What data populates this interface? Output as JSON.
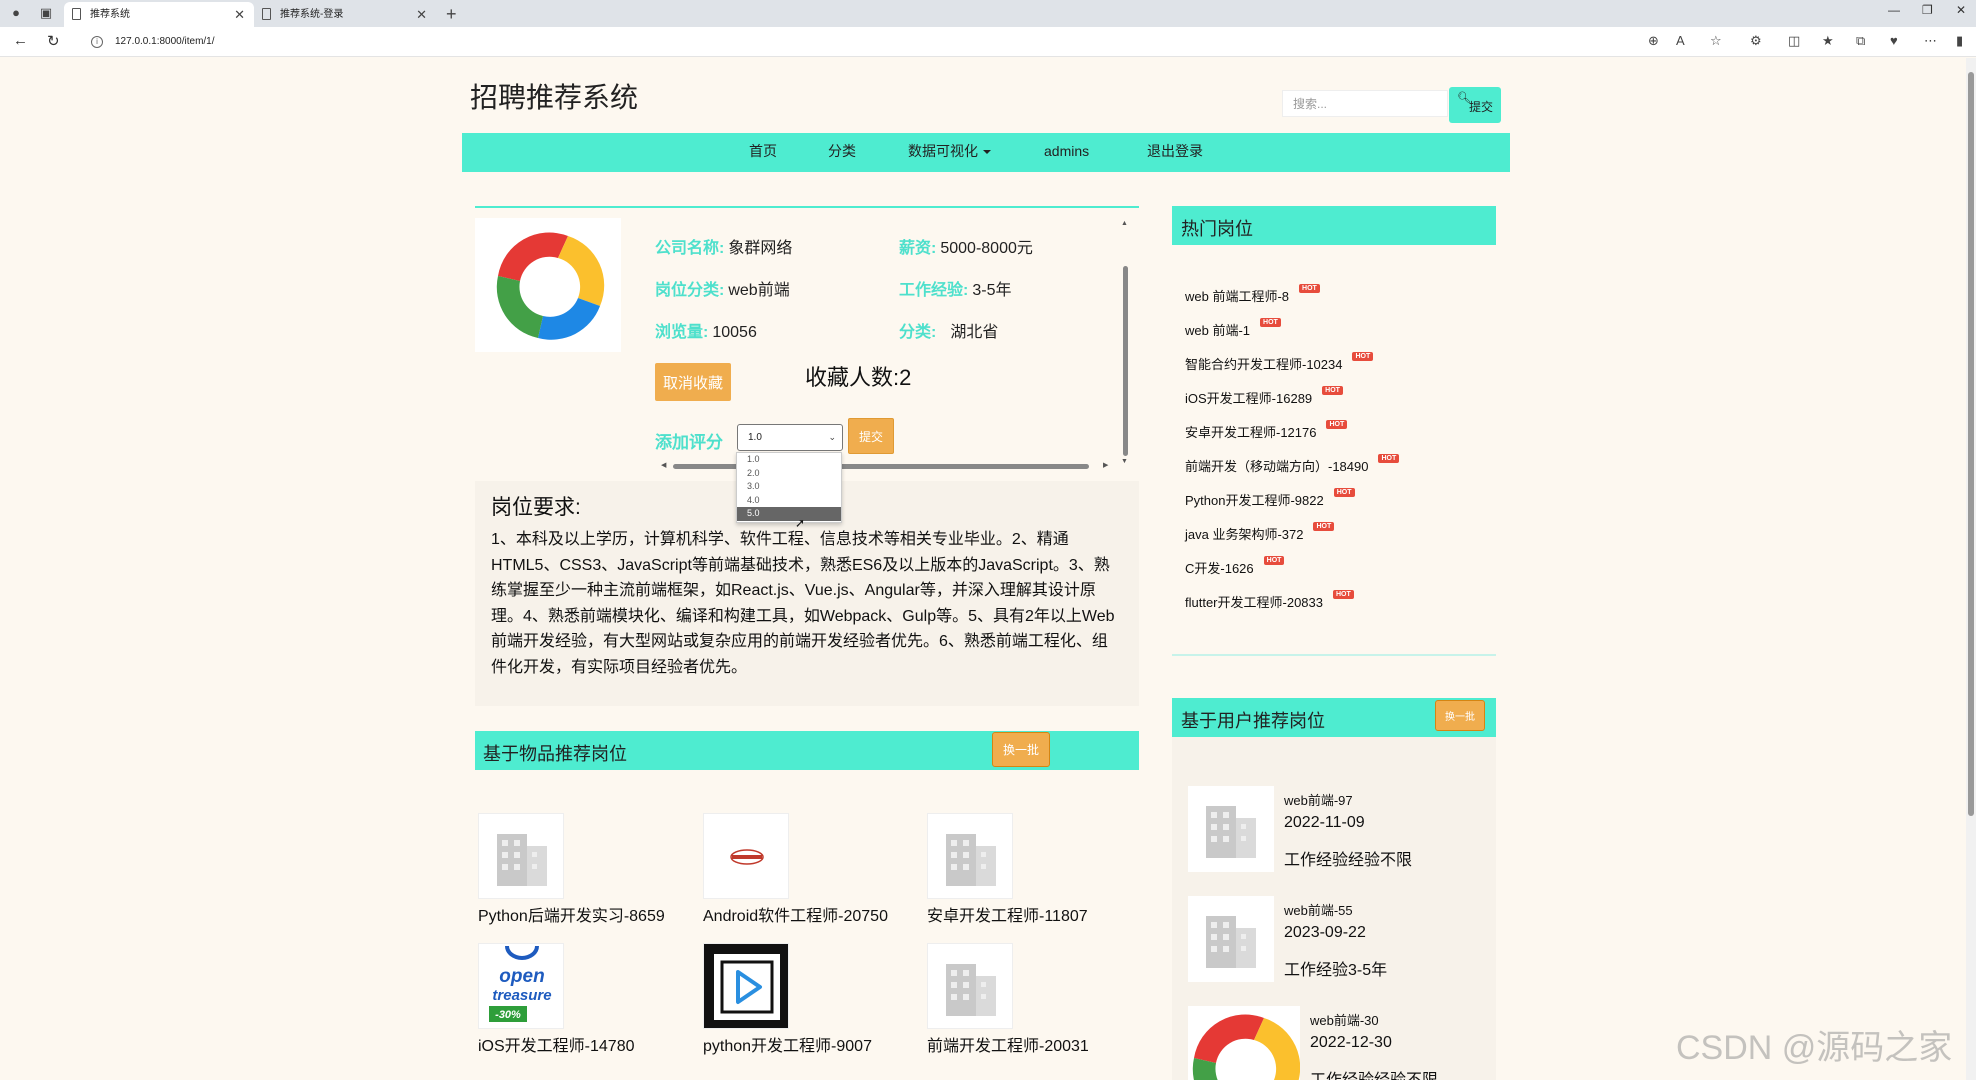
{
  "browser": {
    "tabs": [
      {
        "label": "推荐系统"
      },
      {
        "label": "推荐系统-登录"
      }
    ],
    "url": "127.0.0.1:8000/item/1/"
  },
  "site": {
    "title": "招聘推荐系统",
    "search_placeholder": "搜索...",
    "search_button": "提交"
  },
  "nav": {
    "items": [
      "首页",
      "分类",
      "数据可视化",
      "admins",
      "退出登录"
    ]
  },
  "job": {
    "company_label": "公司名称:",
    "company": "象群网络",
    "salary_label": "薪资:",
    "salary": "5000-8000元",
    "category_label": "岗位分类:",
    "category": "web前端",
    "experience_label": "工作经验:",
    "experience": "3-5年",
    "views_label": "浏览量:",
    "views": "10056",
    "region_label": "分类:",
    "region": "湖北省",
    "cancel_favorite": "取消收藏",
    "favorite_count": "收藏人数:2",
    "rating_label": "添加评分",
    "rating_value": "1.0",
    "rating_submit": "提交",
    "rating_options": [
      "1.0",
      "2.0",
      "3.0",
      "4.0",
      "5.0"
    ]
  },
  "requirements": {
    "title": "岗位要求:",
    "text": "1、本科及以上学历，计算机科学、软件工程、信息技术等相关专业毕业。2、精通HTML5、CSS3、JavaScript等前端基础技术，熟悉ES6及以上版本的JavaScript。3、熟练掌握至少一种主流前端框架，如React.js、Vue.js、Angular等，并深入理解其设计原理。4、熟悉前端模块化、编译和构建工具，如Webpack、Gulp等。5、具有2年以上Web前端开发经验，有大型网站或复杂应用的前端开发经验者优先。6、熟悉前端工程化、组件化开发，有实际项目经验者优先。"
  },
  "item_recommend": {
    "title": "基于物品推荐岗位",
    "swap_button": "换一批",
    "cards": [
      {
        "name": "Python后端开发实习-8659",
        "img": "building-icon"
      },
      {
        "name": "Android软件工程师-20750",
        "img": "company-logo"
      },
      {
        "name": "安卓开发工程师-11807",
        "img": "building-icon"
      },
      {
        "name": "iOS开发工程师-14780",
        "img": "open-treasure-logo",
        "logo_text": [
          "open",
          "treasure",
          "-30%"
        ]
      },
      {
        "name": "python开发工程师-9007",
        "img": "play-logo"
      },
      {
        "name": "前端开发工程师-20031",
        "img": "building-icon"
      }
    ]
  },
  "hot_jobs": {
    "title": "热门岗位",
    "badge": "HOT",
    "items": [
      "web 前端工程师-8",
      "web 前端-1",
      "智能合约开发工程师-10234",
      "iOS开发工程师-16289",
      "安卓开发工程师-12176",
      "前端开发（移动端方向）-18490",
      "Python开发工程师-9822",
      "java 业务架构师-372",
      "C开发-1626",
      "flutter开发工程师-20833"
    ]
  },
  "user_recommend": {
    "title": "基于用户推荐岗位",
    "swap_button": "换一批",
    "cards": [
      {
        "name": "web前端-97",
        "date": "2022-11-09",
        "exp": "工作经验经验不限"
      },
      {
        "name": "web前端-55",
        "date": "2023-09-22",
        "exp": "工作经验3-5年"
      },
      {
        "name": "web前端-30",
        "date": "2022-12-30",
        "exp": "工作经验经验不限"
      }
    ]
  },
  "watermark": "CSDN @源码之家",
  "colors": {
    "accent": "#4eecd0",
    "button": "#f0ad4e",
    "label": "#4ee0cc",
    "page_bg": "#fdf8f0"
  }
}
